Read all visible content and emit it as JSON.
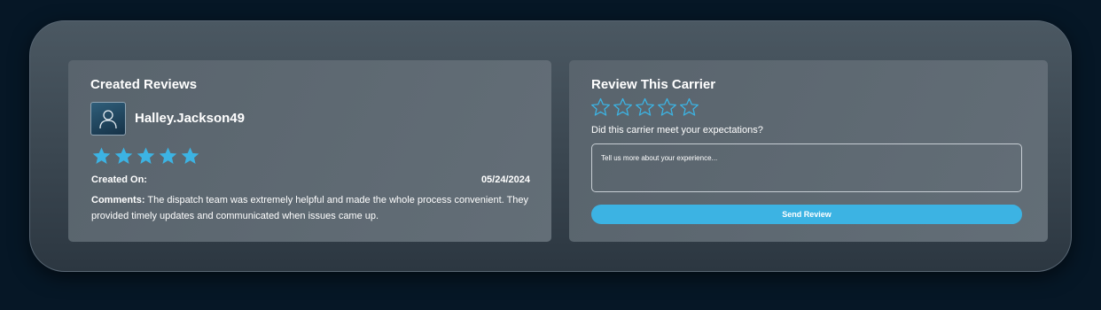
{
  "created_reviews": {
    "title": "Created Reviews",
    "avatar_icon": "user-icon",
    "username": "Halley.Jackson49",
    "rating": 5,
    "max_rating": 5,
    "star_color": "#3cb3e3",
    "created_on_label": "Created On:",
    "created_on_date": "05/24/2024",
    "comments_label": "Comments:",
    "comments_text": "The dispatch team was extremely helpful and made the whole process convenient. They provided timely updates and communicated when issues came up."
  },
  "review_carrier": {
    "title": "Review This Carrier",
    "rating": 0,
    "max_rating": 5,
    "star_color": "#3cb3e3",
    "question": "Did this carrier meet your expectations?",
    "textarea_placeholder": "Tell us more about your experience...",
    "send_label": "Send Review",
    "button_color": "#3cb3e3"
  }
}
